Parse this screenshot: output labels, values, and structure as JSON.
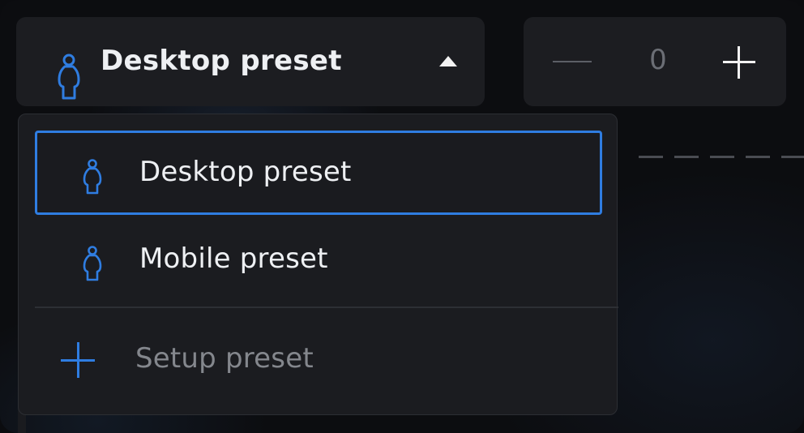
{
  "preset_select": {
    "label": "Desktop preset",
    "icon": "person-icon",
    "state": "expanded"
  },
  "stepper": {
    "value": "0",
    "minus_icon": "minus-icon",
    "plus_icon": "plus-icon"
  },
  "dropdown": {
    "items": [
      {
        "label": "Desktop preset",
        "icon": "person-icon",
        "selected": true
      },
      {
        "label": "Mobile preset",
        "icon": "person-icon",
        "selected": false
      }
    ],
    "action": {
      "label": "Setup preset",
      "icon": "plus-icon"
    }
  },
  "colors": {
    "accent": "#2f7de1",
    "surface": "#1c1d21",
    "text_primary": "#eef0f3",
    "text_muted": "#84878d"
  }
}
